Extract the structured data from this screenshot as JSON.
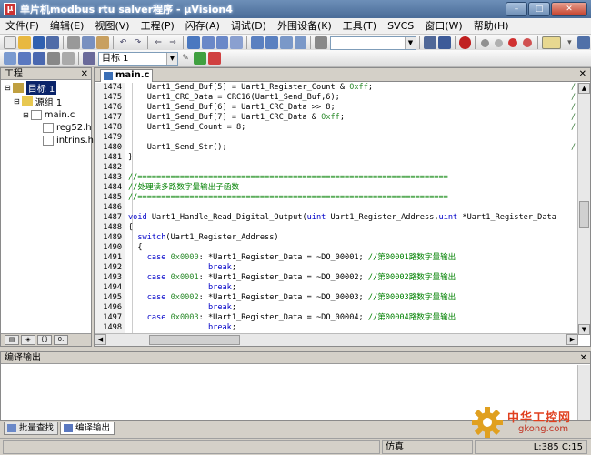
{
  "window": {
    "title": "单片机modbus rtu salver程序 - µVision4",
    "min": "–",
    "max": "□",
    "close": "✕"
  },
  "menu": [
    "文件(F)",
    "编辑(E)",
    "视图(V)",
    "工程(P)",
    "闪存(A)",
    "调试(D)",
    "外围设备(K)",
    "工具(T)",
    "SVCS",
    "窗口(W)",
    "帮助(H)"
  ],
  "toolbar": {
    "target_combo": "目标 1"
  },
  "project_panel": {
    "title": "工程",
    "tree": [
      {
        "label": "目标 1",
        "level": 0,
        "icon": "target-icon"
      },
      {
        "label": "源组 1",
        "level": 1,
        "icon": "folder-icon"
      },
      {
        "label": "main.c",
        "level": 2,
        "icon": "c-file-icon"
      },
      {
        "label": "reg52.h",
        "level": 3,
        "icon": "h-file-icon"
      },
      {
        "label": "intrins.h",
        "level": 3,
        "icon": "h-file-icon"
      }
    ]
  },
  "editor": {
    "tab": "main.c",
    "lines": [
      {
        "n": "1474",
        "t": "    Uart1_Send_Buf[5] = Uart1_Register_Count & 0xff;",
        "tail": "/"
      },
      {
        "n": "1475",
        "t": "    Uart1_CRC_Data = CRC16(Uart1_Send_Buf,6);",
        "tail": "/"
      },
      {
        "n": "1476",
        "t": "    Uart1_Send_Buf[6] = Uart1_CRC_Data >> 8;",
        "tail": "/"
      },
      {
        "n": "1477",
        "t": "    Uart1_Send_Buf[7] = Uart1_CRC_Data & 0xff;",
        "tail": "/"
      },
      {
        "n": "1478",
        "t": "    Uart1_Send_Count = 8;",
        "tail": "/"
      },
      {
        "n": "1479",
        "t": "",
        "tail": ""
      },
      {
        "n": "1480",
        "t": "    Uart1_Send_Str();",
        "tail": "/"
      },
      {
        "n": "1481",
        "t": "}",
        "tail": ""
      },
      {
        "n": "1482",
        "t": "",
        "tail": ""
      },
      {
        "n": "1483",
        "t": "//==================================================================",
        "tail": "",
        "cls": "cm"
      },
      {
        "n": "1484",
        "t": "//处理读多路数字量输出子函数",
        "tail": "",
        "cls": "cm"
      },
      {
        "n": "1485",
        "t": "//==================================================================",
        "tail": "",
        "cls": "cm"
      },
      {
        "n": "1486",
        "t": "",
        "tail": ""
      },
      {
        "n": "1487",
        "t": "void Uart1_Handle_Read_Digital_Output(uint Uart1_Register_Address,uint *Uart1_Register_Data",
        "tail": ""
      },
      {
        "n": "1488",
        "t": "{",
        "tail": ""
      },
      {
        "n": "1489",
        "t": "  switch(Uart1_Register_Address)",
        "tail": ""
      },
      {
        "n": "1490",
        "t": "  {",
        "tail": ""
      },
      {
        "n": "1491",
        "t": "    case 0x0000: *Uart1_Register_Data = ~DO_00001; //第00001路数字量输出",
        "tail": ""
      },
      {
        "n": "1492",
        "t": "                 break;",
        "tail": ""
      },
      {
        "n": "1493",
        "t": "    case 0x0001: *Uart1_Register_Data = ~DO_00002; //第00002路数字量输出",
        "tail": ""
      },
      {
        "n": "1494",
        "t": "                 break;",
        "tail": ""
      },
      {
        "n": "1495",
        "t": "    case 0x0002: *Uart1_Register_Data = ~DO_00003; //第00003路数字量输出",
        "tail": ""
      },
      {
        "n": "1496",
        "t": "                 break;",
        "tail": ""
      },
      {
        "n": "1497",
        "t": "    case 0x0003: *Uart1_Register_Data = ~DO_00004; //第00004路数字量输出",
        "tail": ""
      },
      {
        "n": "1498",
        "t": "                 break;",
        "tail": ""
      }
    ]
  },
  "output_panel": {
    "title": "编译输出",
    "tabs": [
      "批量查找",
      "编译输出"
    ]
  },
  "status": {
    "mode": "仿真",
    "position": "L:385 C:15"
  },
  "watermark": {
    "brand": "中华工控网",
    "site": "gkong.com"
  }
}
